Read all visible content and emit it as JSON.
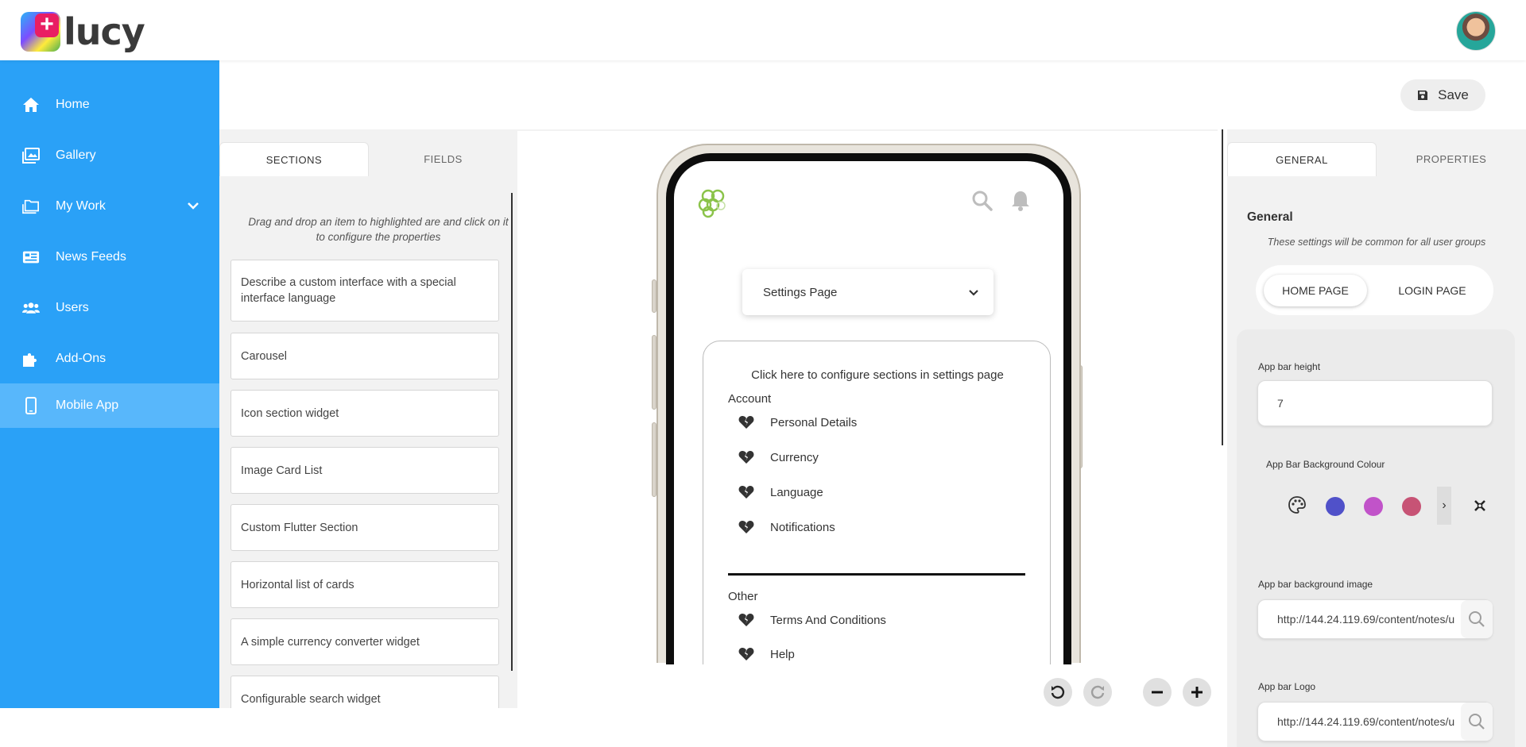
{
  "app": {
    "logo_text": "lucy",
    "logo_plus": "+"
  },
  "sidebar": {
    "items": [
      {
        "label": "Home",
        "icon": "home-icon"
      },
      {
        "label": "Gallery",
        "icon": "gallery-icon"
      },
      {
        "label": "My Work",
        "icon": "folder-icon"
      },
      {
        "label": "News Feeds",
        "icon": "news-icon"
      },
      {
        "label": "Users",
        "icon": "users-icon"
      },
      {
        "label": "Add-Ons",
        "icon": "puzzle-icon"
      },
      {
        "label": "Mobile App",
        "icon": "mobile-icon",
        "active": true
      }
    ]
  },
  "toolbar": {
    "save_label": "Save"
  },
  "left_panel": {
    "tabs": [
      "SECTIONS",
      "FIELDS"
    ],
    "hint": "Drag and drop an item to highlighted are and click on it to configure the properties",
    "widgets": [
      "Describe a custom interface with a special interface language",
      "Carousel",
      "Icon section widget",
      "Image Card List",
      "Custom Flutter Section",
      "Horizontal list of cards",
      "A simple currency converter widget",
      "Configurable search widget"
    ]
  },
  "preview": {
    "dropdown_value": "Settings Page",
    "card_hint": "Click here to configure sections in settings page",
    "groups": [
      {
        "title": "Account",
        "items": [
          "Personal Details",
          "Currency",
          "Language",
          "Notifications"
        ]
      },
      {
        "title": "Other",
        "items": [
          "Terms And Conditions",
          "Help"
        ]
      }
    ]
  },
  "right_panel": {
    "tabs": [
      "GENERAL",
      "PROPERTIES"
    ],
    "title": "General",
    "subtitle": "These settings will be common for all user groups",
    "toggle": [
      "HOME PAGE",
      "LOGIN PAGE"
    ],
    "fields": {
      "app_bar_height_label": "App bar height",
      "app_bar_height_value": "7",
      "bg_colour_label": "App Bar Background Colour",
      "bg_image_label": "App bar background image",
      "bg_image_value": "http://144.24.119.69/content/notes/u",
      "logo_label": "App bar Logo",
      "logo_value": "http://144.24.119.69/content/notes/u"
    },
    "swatches": [
      "#5051c9",
      "#c153c9",
      "#c75375"
    ]
  },
  "colors": {
    "sidebar": "#2aa1f7",
    "sidebar_active": "#58b7fb"
  }
}
